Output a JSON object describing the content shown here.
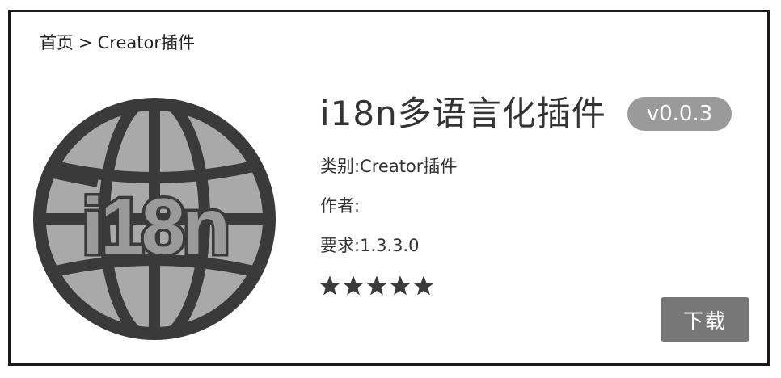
{
  "breadcrumb": {
    "home": "首页",
    "separator": ">",
    "current": "Creator插件"
  },
  "plugin": {
    "icon": "globe-icon",
    "icon_text": "i18n",
    "title": "i18n多语言化插件",
    "version": "v0.0.3",
    "category_label": "类别:",
    "category_value": "Creator插件",
    "author_label": "作者:",
    "author_value": "",
    "requirement_label": "要求:",
    "requirement_value": "1.3.3.0",
    "rating": 5,
    "rating_max": 5
  },
  "actions": {
    "download_label": "下载"
  },
  "colors": {
    "globe_fill": "#a9a9a9",
    "globe_stroke": "#3a3a3a",
    "badge": "#9a9a9a",
    "button": "#777777",
    "star": "#3a3a3a"
  }
}
